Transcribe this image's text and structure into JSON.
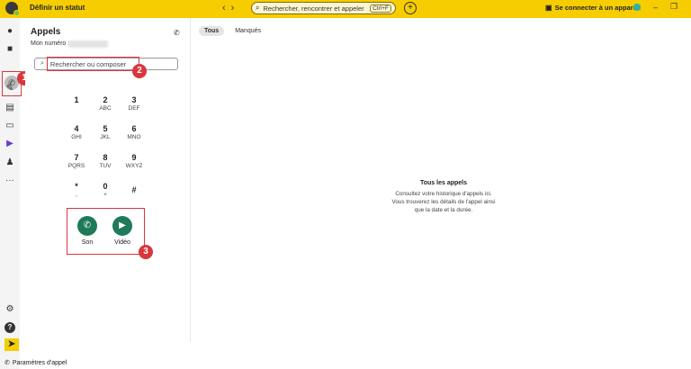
{
  "topbar": {
    "status_label": "Définir un statut",
    "back_glyph": "‹",
    "forward_glyph": "›",
    "search_placeholder": "Rechercher, rencontrer et appeler",
    "search_shortcut": "Ctrl+F",
    "add_glyph": "+",
    "connect_label": "Se connecter à un appareil",
    "minimize_glyph": "–",
    "maximize_glyph": "❐",
    "close_glyph": "✕"
  },
  "rail": {
    "icons": [
      "chat-icon",
      "calendar-icon",
      "phone-icon",
      "edit-icon",
      "contacts-icon",
      "voicemail-icon",
      "play-icon",
      "people-icon",
      "more-icon",
      "gear-icon",
      "help-icon",
      "arrow-icon"
    ],
    "more_glyph": "···",
    "help_glyph": "?",
    "bottom_glyph": "➤"
  },
  "callouts": {
    "one": "1",
    "two": "2",
    "three": "3"
  },
  "calls_panel": {
    "title": "Appels",
    "my_number_label": "Mon numéro :",
    "search_placeholder": "Rechercher ou composer",
    "keypad": [
      {
        "num": "1",
        "letters": ""
      },
      {
        "num": "2",
        "letters": "ABC"
      },
      {
        "num": "3",
        "letters": "DEF"
      },
      {
        "num": "4",
        "letters": "GHI"
      },
      {
        "num": "5",
        "letters": "JKL"
      },
      {
        "num": "6",
        "letters": "MNO"
      },
      {
        "num": "7",
        "letters": "PQRS"
      },
      {
        "num": "8",
        "letters": "TUV"
      },
      {
        "num": "9",
        "letters": "WXYZ"
      },
      {
        "num": "*",
        "letters": ","
      },
      {
        "num": "0",
        "letters": "+"
      },
      {
        "num": "#",
        "letters": ""
      }
    ],
    "audio_label": "Son",
    "video_label": "Vidéo"
  },
  "content": {
    "tabs": [
      "Tous",
      "Manqués"
    ],
    "empty_title": "Tous les appels",
    "empty_line1": "Consultez votre historique d'appels ici.",
    "empty_line2": "Vous trouverez les détails de l'appel ainsi",
    "empty_line3": "que la date et la durée."
  },
  "footer": {
    "settings_label": "Paramètres d'appel"
  },
  "colors": {
    "accent_yellow": "#f6cd00",
    "call_green": "#1f7a5a",
    "highlight_red": "#d9363e"
  }
}
